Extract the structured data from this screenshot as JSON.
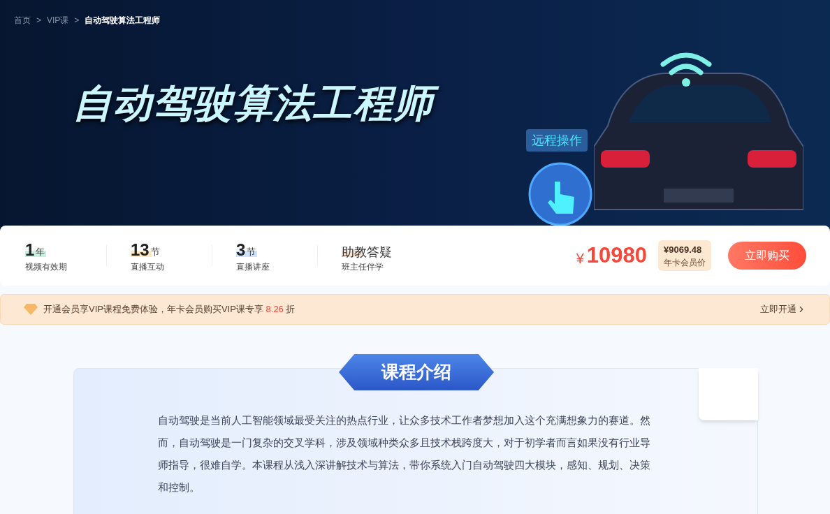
{
  "breadcrumb": [
    {
      "label": "首页",
      "current": false
    },
    {
      "label": "VIP课",
      "current": false
    },
    {
      "label": "自动驾驶算法工程师",
      "current": true
    }
  ],
  "breadcrumb_separator": ">",
  "banner": {
    "title": "自动驾驶算法工程师",
    "tag": "远程操作"
  },
  "stats": [
    {
      "kind": "number",
      "value": "1",
      "unit": "年",
      "label": "视频有效期",
      "color": "#c7f0e0"
    },
    {
      "kind": "number",
      "value": "13",
      "unit": "节",
      "label": "直播互动",
      "color": "#fbe9c2"
    },
    {
      "kind": "number",
      "value": "3",
      "unit": "节",
      "label": "直播讲座",
      "color": "#cfe4fa"
    },
    {
      "kind": "text",
      "value": "助教答疑",
      "label": "班主任伴学",
      "color": "#fbe6d6"
    }
  ],
  "price": {
    "currency": "¥",
    "amount": "10980",
    "member_price": "¥9069.48",
    "member_label": "年卡会员价",
    "buy_button": "立即购买"
  },
  "vip_bar": {
    "text": "开通会员享VIP课程免费体验，年卡会员购买VIP课专享",
    "discount": "8.26",
    "suffix": "折",
    "link": "立即开通"
  },
  "intro": {
    "heading": "课程介绍",
    "body": "自动驾驶是当前人工智能领域最受关注的热点行业，让众多技术工作者梦想加入这个充满想象力的赛道。然而，自动驾驶是一门复杂的交叉学科，涉及领域种类众多且技术栈跨度大，对于初学者而言如果没有行业导师指导，很难自学。本课程从浅入深讲解技术与算法，带你系统入门自动驾驶四大模块，感知、规划、决策和控制。"
  }
}
